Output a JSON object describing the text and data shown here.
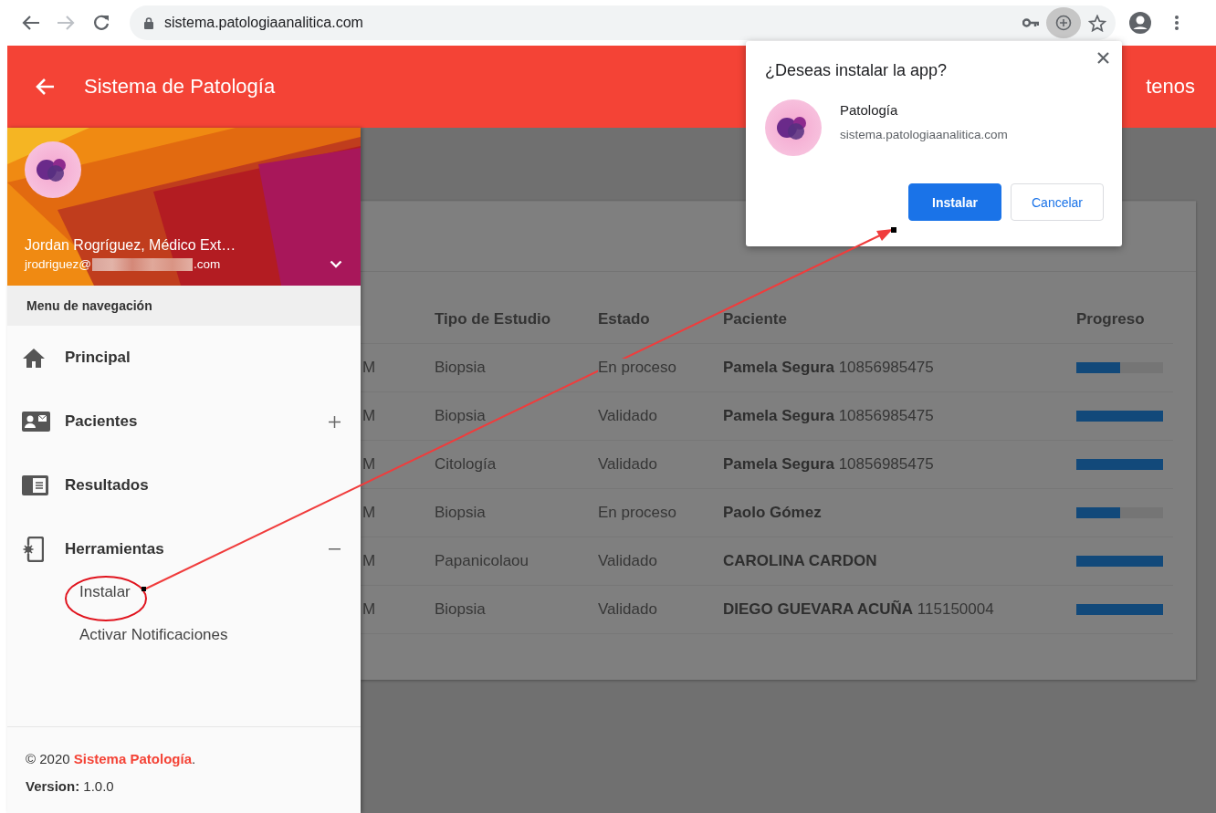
{
  "browser": {
    "url": "sistema.patologiaanalitica.com",
    "forward_disabled": true
  },
  "app_bar": {
    "title": "Sistema de Patología",
    "right_text": "tenos"
  },
  "drawer": {
    "user_name": "Jordan Rogríguez, Médico Ext…",
    "email_prefix": "jrodriguez@",
    "email_suffix": ".com",
    "menu_heading": "Menu de navegación",
    "items": [
      {
        "kind": "link",
        "label": "Principal"
      },
      {
        "kind": "group",
        "label": "Pacientes",
        "expanded": false
      },
      {
        "kind": "link",
        "label": "Resultados"
      },
      {
        "kind": "group",
        "label": "Herramientas",
        "expanded": true,
        "children": [
          {
            "label": "Instalar"
          },
          {
            "label": "Activar Notificaciones"
          }
        ]
      }
    ],
    "footer": {
      "prefix": "© 2020 ",
      "link": "Sistema Patología",
      "suffix": ".",
      "version": "**Version:** 1.0.0"
    }
  },
  "table": {
    "columns": [
      "Tipo de Estudio",
      "Estado",
      "Paciente",
      "Progreso"
    ],
    "rows": [
      {
        "column_1": "M",
        "tipo": "Biopsia",
        "estado": "En proceso",
        "paciente": "**Pamela Segura** 10856985475",
        "level": 0.5
      },
      {
        "column_1": "M",
        "tipo": "Biopsia",
        "estado": "Validado",
        "paciente": "**Pamela Segura** 10856985475",
        "level": 1
      },
      {
        "column_1": "M",
        "tipo": "Citología",
        "estado": "Validado",
        "paciente": "**Pamela Segura** 10856985475",
        "level": 1
      },
      {
        "column_1": "M",
        "tipo": "Biopsia",
        "estado": "En proceso",
        "paciente": "**Paolo Gómez**",
        "level": 0.5
      },
      {
        "column_1": "M",
        "tipo": "Papanicolaou",
        "estado": "Validado",
        "paciente": "**CAROLINA CARDON**",
        "level": 1
      },
      {
        "column_1": "M",
        "tipo": "Biopsia",
        "estado": "Validado",
        "paciente": "**DIEGO GUEVARA ACUÑA** 115150004",
        "level": 1
      }
    ]
  },
  "install_dialog": {
    "title": "¿Deseas instalar la app?",
    "app_name": "Patología",
    "app_url": "sistema.patologiaanalitica.com",
    "buttons": [
      {
        "kind": "primary",
        "label": "Instalar"
      },
      {
        "kind": "secondary",
        "label": "Cancelar"
      }
    ]
  }
}
